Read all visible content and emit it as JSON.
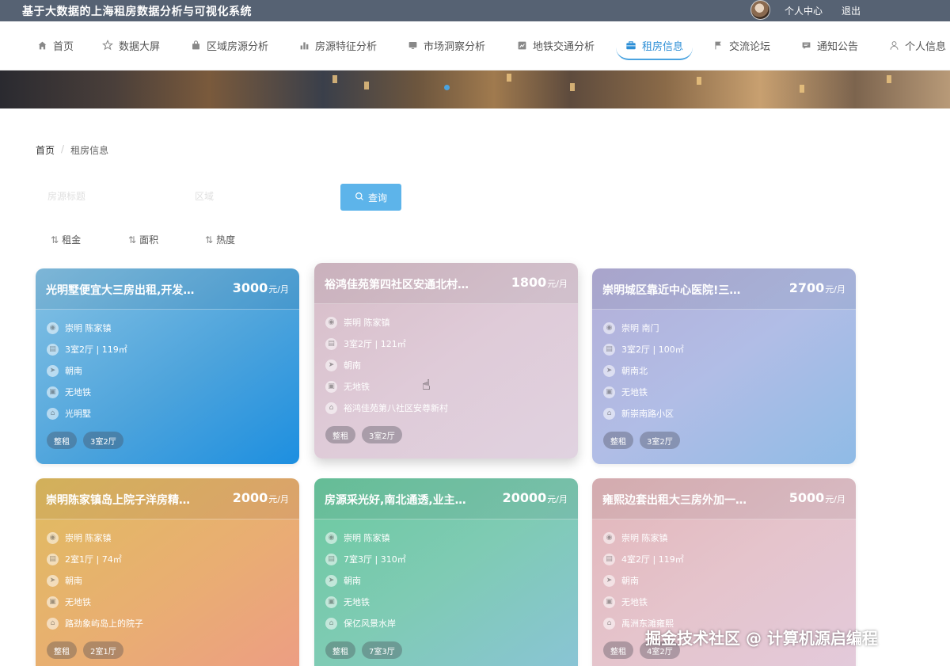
{
  "header": {
    "app_title": "基于大数据的上海租房数据分析与可视化系统",
    "user_center": "个人中心",
    "logout": "退出"
  },
  "nav": {
    "items": [
      {
        "label": "首页",
        "icon": "home-icon"
      },
      {
        "label": "数据大屏",
        "icon": "star-icon"
      },
      {
        "label": "区域房源分析",
        "icon": "bag-icon"
      },
      {
        "label": "房源特征分析",
        "icon": "bar-chart-icon"
      },
      {
        "label": "市场洞察分析",
        "icon": "monitor-icon"
      },
      {
        "label": "地铁交通分析",
        "icon": "chart-box-icon"
      },
      {
        "label": "租房信息",
        "icon": "briefcase-icon"
      },
      {
        "label": "交流论坛",
        "icon": "flag-icon"
      },
      {
        "label": "通知公告",
        "icon": "message-icon"
      },
      {
        "label": "个人信息",
        "icon": "user-icon"
      }
    ],
    "active": "租房信息"
  },
  "breadcrumb": {
    "home": "首页",
    "current": "租房信息"
  },
  "search": {
    "title_placeholder": "房源标题",
    "district_placeholder": "区域",
    "button_label": "查询"
  },
  "sort": {
    "rent": "租金",
    "area": "面积",
    "heat": "热度"
  },
  "listings": [
    {
      "title": "光明墅便宜大三房出租,开发…",
      "price": "3000",
      "unit": "元/月",
      "location": "崇明 陈家镇",
      "layout": "3室2厅 | 119㎡",
      "orientation": "朝南",
      "subway": "无地铁",
      "community": "光明墅",
      "tags": [
        "整租",
        "3室2厅"
      ]
    },
    {
      "title": "裕鸿佳苑第四社区安通北村…",
      "price": "1800",
      "unit": "元/月",
      "location": "崇明 陈家镇",
      "layout": "3室2厅 | 121㎡",
      "orientation": "朝南",
      "subway": "无地铁",
      "community": "裕鸿佳苑第八社区安尊新村",
      "tags": [
        "整租",
        "3室2厅"
      ]
    },
    {
      "title": "崇明城区靠近中心医院!三…",
      "price": "2700",
      "unit": "元/月",
      "location": "崇明 南门",
      "layout": "3室2厅 | 100㎡",
      "orientation": "朝南北",
      "subway": "无地铁",
      "community": "新崇南路小区",
      "tags": [
        "整租",
        "3室2厅"
      ]
    },
    {
      "title": "崇明陈家镇岛上院子洋房精…",
      "price": "2000",
      "unit": "元/月",
      "location": "崇明 陈家镇",
      "layout": "2室1厅 | 74㎡",
      "orientation": "朝南",
      "subway": "无地铁",
      "community": "路劲象屿岛上的院子",
      "tags": [
        "整租",
        "2室1厅"
      ]
    },
    {
      "title": "房源采光好,南北通透,业主…",
      "price": "20000",
      "unit": "元/月",
      "location": "崇明 陈家镇",
      "layout": "7室3厅 | 310㎡",
      "orientation": "朝南",
      "subway": "无地铁",
      "community": "保亿风景水岸",
      "tags": [
        "整租",
        "7室3厅"
      ]
    },
    {
      "title": "雍熙边套出租大三房外加一…",
      "price": "5000",
      "unit": "元/月",
      "location": "崇明 陈家镇",
      "layout": "4室2厅 | 119㎡",
      "orientation": "朝南",
      "subway": "无地铁",
      "community": "禹洲东滩雍熙",
      "tags": [
        "整租",
        "4室2厅"
      ]
    }
  ],
  "watermark": "掘金技术社区 @ 计算机源启编程"
}
